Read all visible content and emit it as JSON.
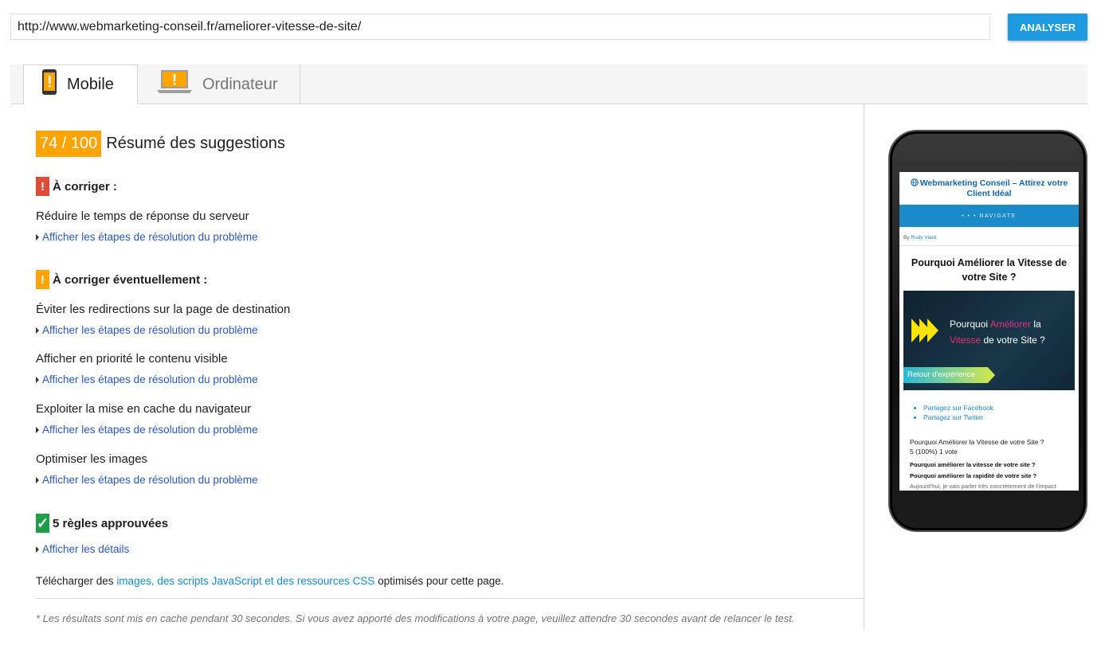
{
  "url_bar": {
    "value": "http://www.webmarketing-conseil.fr/ameliorer-vitesse-de-site/",
    "button_label": "ANALYSER"
  },
  "tabs": [
    {
      "label": "Mobile",
      "icon": "mobile-warning-icon",
      "active": true
    },
    {
      "label": "Ordinateur",
      "icon": "laptop-warning-icon",
      "active": false
    }
  ],
  "summary": {
    "score": "74 / 100",
    "title": "Résumé des suggestions"
  },
  "sections": {
    "fix": {
      "heading": "À corriger :",
      "icon_symbol": "!",
      "color": "#dd4b39",
      "rules": [
        {
          "title": "Réduire le temps de réponse du serveur",
          "link": "Afficher les étapes de résolution du problème"
        }
      ]
    },
    "consider": {
      "heading": "À corriger éventuellement :",
      "icon_symbol": "!",
      "color": "#ffa400",
      "rules": [
        {
          "title": "Éviter les redirections sur la page de destination",
          "link": "Afficher les étapes de résolution du problème"
        },
        {
          "title": "Afficher en priorité le contenu visible",
          "link": "Afficher les étapes de résolution du problème"
        },
        {
          "title": "Exploiter la mise en cache du navigateur",
          "link": "Afficher les étapes de résolution du problème"
        },
        {
          "title": "Optimiser les images",
          "link": "Afficher les étapes de résolution du problème"
        }
      ]
    },
    "passed": {
      "heading": "5 règles approuvées",
      "icon_symbol": "✓",
      "color": "#1e9e4a",
      "link": "Afficher les détails"
    }
  },
  "download": {
    "prefix": "Télécharger des ",
    "link": "images, des scripts JavaScript et des ressources CSS",
    "suffix": " optimisés pour cette page."
  },
  "cache_note": "* Les résultats sont mis en cache pendant 30 secondes. Si vous avez apporté des modifications à votre page, veuillez attendre 30 secondes avant de relancer le test.",
  "phone_preview": {
    "site_title": "Webmarketing Conseil – Attirez votre Client Idéal",
    "nav_label": "• • •   NAVIGATE",
    "byline_prefix": "By ",
    "author": "Rudy Viard",
    "article_title": "Pourquoi Améliorer la Vitesse de votre Site ?",
    "banner": {
      "line1_a": "Pourquoi ",
      "line1_b": "Améliorer",
      "line1_c": " la",
      "line2_a": "Vitesse",
      "line2_b": " de votre Site ?",
      "ribbon": "Retour d'expérience"
    },
    "share": [
      "Partagez sur Facebook",
      "Partagez sur Twitter"
    ],
    "rating_title": "Pourquoi Améliorer la Vitesse de votre Site ?",
    "rating_value": "5 (100%) 1 vote",
    "bold_lines": [
      "Pourquoi améliorer la vitesse de votre site ?",
      "Pourquoi améliorer la rapidité de votre site ?"
    ],
    "fade_line": "Aujourd'hui, je vais parler très concrètement de l'impact"
  },
  "colors": {
    "accent": "#1e9be0",
    "score": "#ffa400",
    "link": "#2b5ab8"
  }
}
